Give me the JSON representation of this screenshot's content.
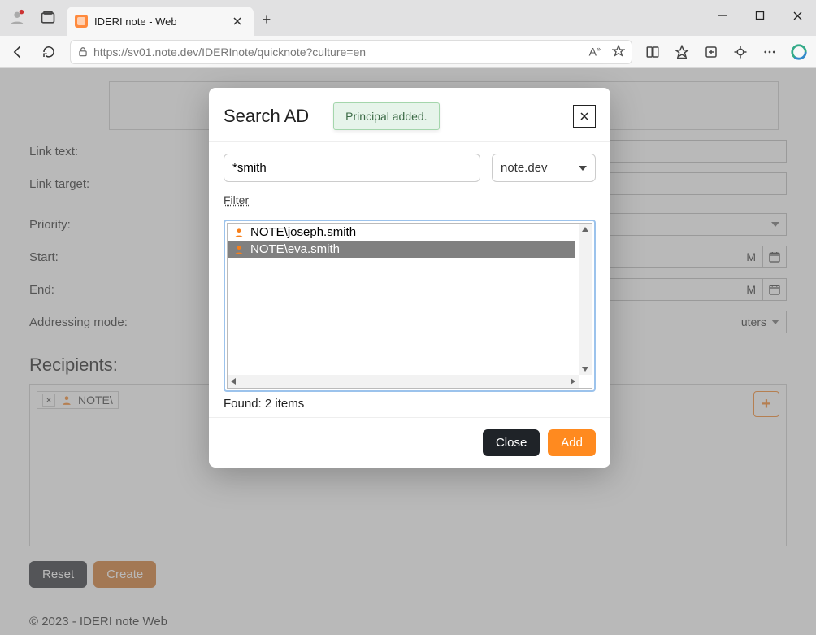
{
  "browser": {
    "tab_title": "IDERI note - Web",
    "url_display": "https://sv01.note.dev/IDERInote/quicknote?culture=en"
  },
  "form": {
    "link_text_label": "Link text:",
    "link_target_label": "Link target:",
    "priority_label": "Priority:",
    "start_label": "Start:",
    "end_label": "End:",
    "start_value": "M",
    "end_value": "M",
    "addressing_label": "Addressing mode:",
    "addressing_value": "uters",
    "recipients_title": "Recipients:",
    "chip_text": "NOTE\\",
    "reset": "Reset",
    "create": "Create"
  },
  "footer": "© 2023 - IDERI note Web",
  "modal": {
    "title": "Search AD",
    "toast": "Principal added.",
    "search_value": "*smith",
    "domain_value": "note.dev",
    "filter_label": "Filter",
    "results": [
      {
        "label": "NOTE\\joseph.smith",
        "selected": false
      },
      {
        "label": "NOTE\\eva.smith",
        "selected": true
      }
    ],
    "found": "Found: 2 items",
    "close": "Close",
    "add": "Add"
  }
}
